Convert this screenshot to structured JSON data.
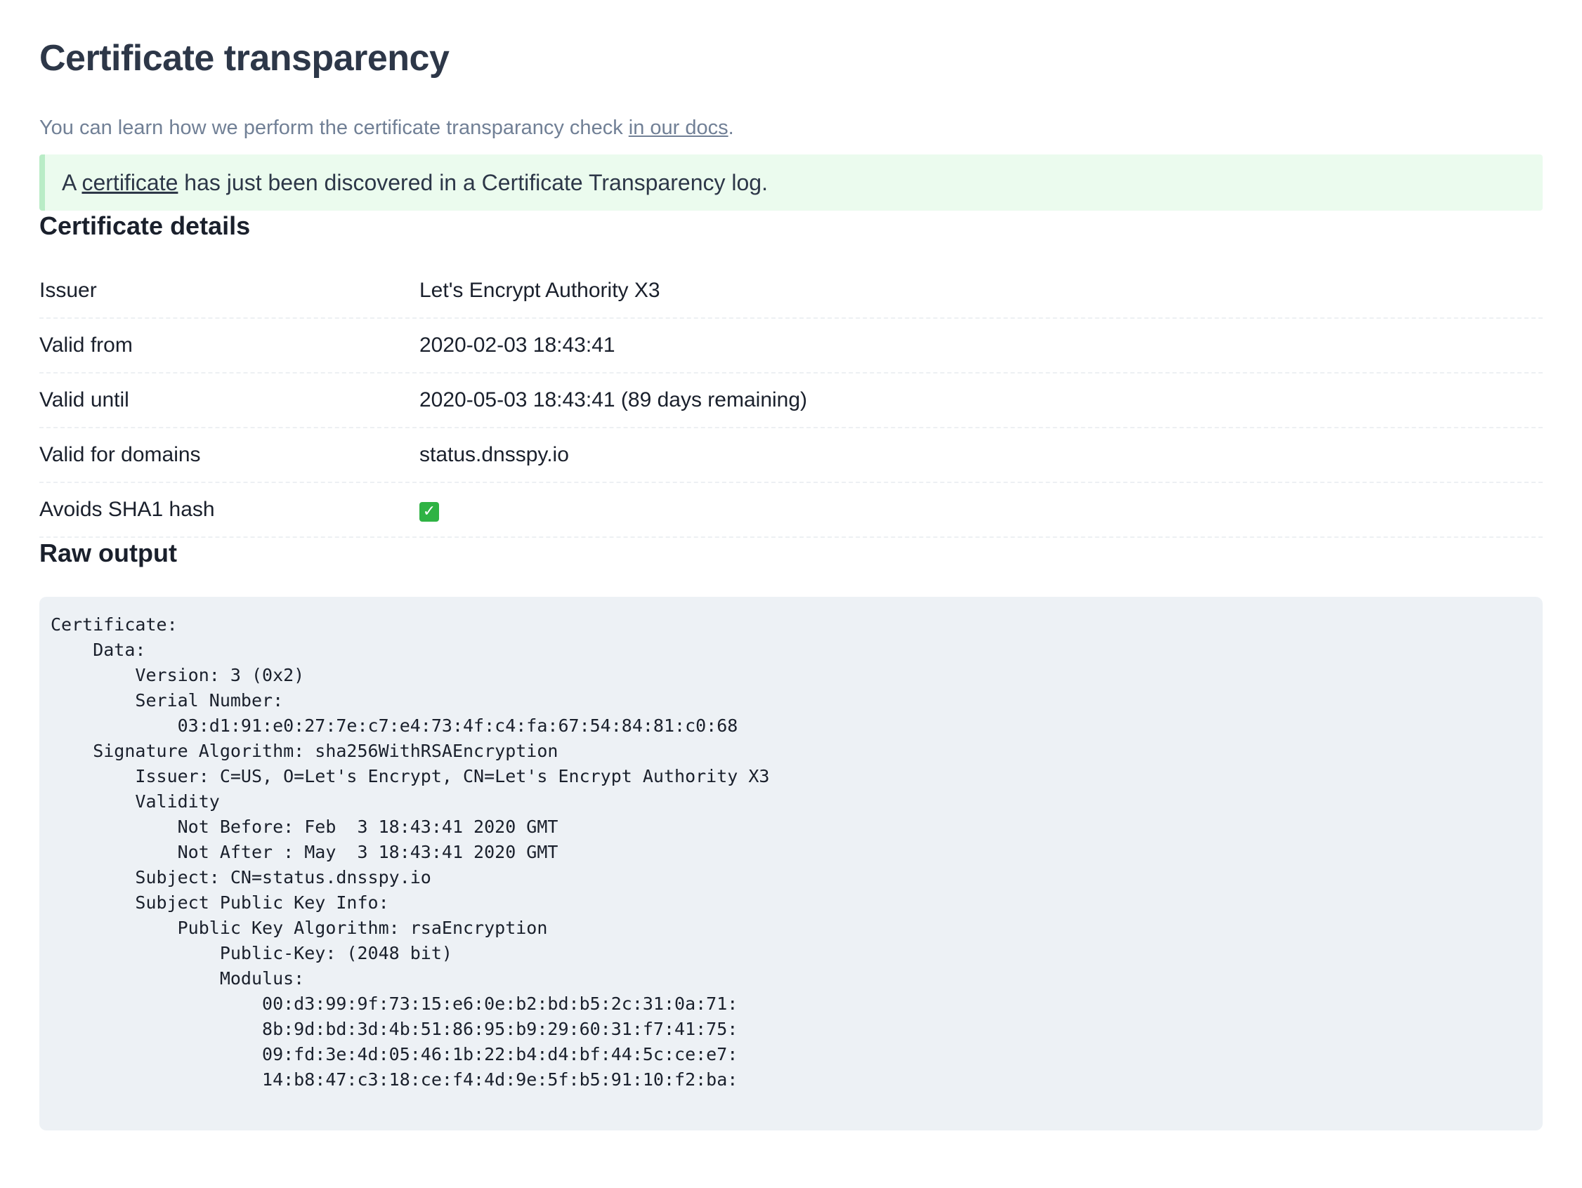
{
  "page": {
    "title": "Certificate transparency",
    "intro_text": "You can learn how we perform the certificate transparancy check ",
    "intro_link": "in our docs",
    "intro_end": "."
  },
  "alert": {
    "prefix": "A ",
    "link": "certificate",
    "suffix": " has just been discovered in a Certificate Transparency log."
  },
  "details": {
    "heading": "Certificate details",
    "rows": [
      {
        "label": "Issuer",
        "value": "Let's Encrypt Authority X3"
      },
      {
        "label": "Valid from",
        "value": "2020-02-03 18:43:41"
      },
      {
        "label": "Valid until",
        "value": "2020-05-03 18:43:41 (89 days remaining)"
      },
      {
        "label": "Valid for domains",
        "value": "status.dnsspy.io"
      },
      {
        "label": "Avoids SHA1 hash",
        "value": "✓"
      }
    ]
  },
  "raw": {
    "heading": "Raw output",
    "text": "Certificate:\n    Data:\n        Version: 3 (0x2)\n        Serial Number:\n            03:d1:91:e0:27:7e:c7:e4:73:4f:c4:fa:67:54:84:81:c0:68\n    Signature Algorithm: sha256WithRSAEncryption\n        Issuer: C=US, O=Let's Encrypt, CN=Let's Encrypt Authority X3\n        Validity\n            Not Before: Feb  3 18:43:41 2020 GMT\n            Not After : May  3 18:43:41 2020 GMT\n        Subject: CN=status.dnsspy.io\n        Subject Public Key Info:\n            Public Key Algorithm: rsaEncryption\n                Public-Key: (2048 bit)\n                Modulus:\n                    00:d3:99:9f:73:15:e6:0e:b2:bd:b5:2c:31:0a:71:\n                    8b:9d:bd:3d:4b:51:86:95:b9:29:60:31:f7:41:75:\n                    09:fd:3e:4d:05:46:1b:22:b4:d4:bf:44:5c:ce:e7:\n                    14:b8:47:c3:18:ce:f4:4d:9e:5f:b5:91:10:f2:ba:"
  }
}
